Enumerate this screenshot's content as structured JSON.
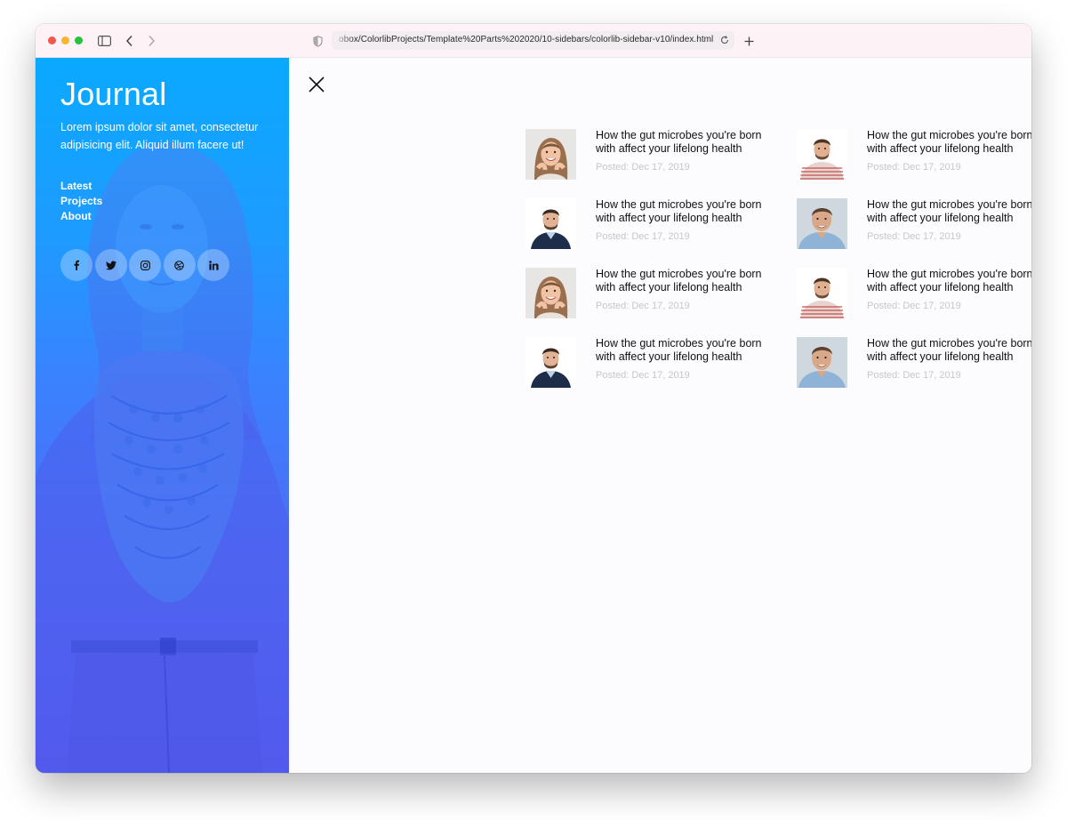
{
  "browser": {
    "url": "obox/ColorlibProjects/Template%20Parts%202020/10-sidebars/colorlib-sidebar-v10/index.html",
    "traffic_lights": [
      "#f2574b",
      "#f5b52e",
      "#27c13f"
    ],
    "icons": [
      "sidebar-toggle-icon",
      "back-icon",
      "forward-icon",
      "shield-icon",
      "reload-icon",
      "new-tab-icon"
    ]
  },
  "sidebar": {
    "brand": "Journal",
    "tagline": "Lorem ipsum dolor sit amet, consectetur adipisicing elit. Aliquid illum facere ut!",
    "nav": [
      "Latest",
      "Projects",
      "About"
    ],
    "socials": [
      {
        "icon": "facebook-icon",
        "glyph": "f"
      },
      {
        "icon": "twitter-icon",
        "glyph": ""
      },
      {
        "icon": "instagram-icon",
        "glyph": ""
      },
      {
        "icon": "dribbble-icon",
        "glyph": ""
      },
      {
        "icon": "linkedin-icon",
        "glyph": "in"
      }
    ],
    "gradient_colors": [
      "#0aa9ff",
      "#5a55ee"
    ]
  },
  "main": {
    "close_icon": "close-icon",
    "posts": [
      {
        "title_line1": "How the gut microbes you're born",
        "title_line2": "with affect your lifelong health",
        "date": "Posted: Dec 17, 2019",
        "avatar": "woman-smiling"
      },
      {
        "title_line1": "How the gut microbes you're born",
        "title_line2": "with affect your lifelong health",
        "date": "Posted: Dec 17, 2019",
        "avatar": "man-striped-shirt"
      },
      {
        "title_line1": "How the gut microbes you're born",
        "title_line2": "with affect your lifelong health",
        "date": "Posted: Dec 17, 2019",
        "avatar": "man-sweater"
      },
      {
        "title_line1": "How the gut microbes you're born",
        "title_line2": "with affect your lifelong health",
        "date": "Posted: Dec 17, 2019",
        "avatar": "man-blue-shirt"
      },
      {
        "title_line1": "How the gut microbes you're born",
        "title_line2": "with affect your lifelong health",
        "date": "Posted: Dec 17, 2019",
        "avatar": "woman-smiling"
      },
      {
        "title_line1": "How the gut microbes you're born",
        "title_line2": "with affect your lifelong health",
        "date": "Posted: Dec 17, 2019",
        "avatar": "man-striped-shirt"
      },
      {
        "title_line1": "How the gut microbes you're born",
        "title_line2": "with affect your lifelong health",
        "date": "Posted: Dec 17, 2019",
        "avatar": "man-sweater"
      },
      {
        "title_line1": "How the gut microbes you're born",
        "title_line2": "with affect your lifelong health",
        "date": "Posted: Dec 17, 2019",
        "avatar": "man-blue-shirt"
      }
    ]
  }
}
